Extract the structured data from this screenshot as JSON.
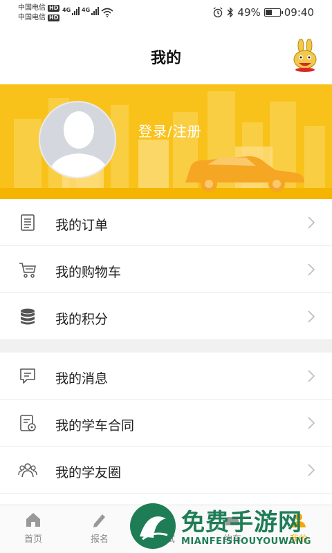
{
  "status_bar": {
    "carrier_1": "中国电信",
    "carrier_2": "中国电信",
    "hd_badge": "HD",
    "network_1": "4G",
    "network_2": "4G",
    "battery_percent": "49%",
    "battery_level": 0.49,
    "time": "09:40",
    "icons": [
      "alarm-icon",
      "bluetooth-icon",
      "wifi-icon"
    ]
  },
  "header": {
    "title": "我的"
  },
  "banner": {
    "login_text": "登录/注册",
    "color": "#f9c21a"
  },
  "menu": {
    "group_1": [
      {
        "label": "我的订单",
        "icon": "orders-icon"
      },
      {
        "label": "我的购物车",
        "icon": "cart-icon"
      },
      {
        "label": "我的积分",
        "icon": "points-icon"
      }
    ],
    "group_2": [
      {
        "label": "我的消息",
        "icon": "message-icon"
      },
      {
        "label": "我的学车合同",
        "icon": "contract-icon"
      },
      {
        "label": "我的学友圈",
        "icon": "friends-icon"
      }
    ]
  },
  "tab_bar": {
    "tabs": [
      {
        "label": "首页",
        "icon": "home-icon"
      },
      {
        "label": "报名",
        "icon": "edit-icon"
      },
      {
        "label": "考试",
        "icon": "exam-icon"
      },
      {
        "label": "约车",
        "icon": "car-icon"
      },
      {
        "label": "我的",
        "icon": "profile-icon"
      }
    ],
    "active_color": "#f6a800"
  },
  "watermark": {
    "title": "免费手游网",
    "subtitle": "MIANFEISHOUYOUWANG",
    "color": "#1f7d56"
  }
}
